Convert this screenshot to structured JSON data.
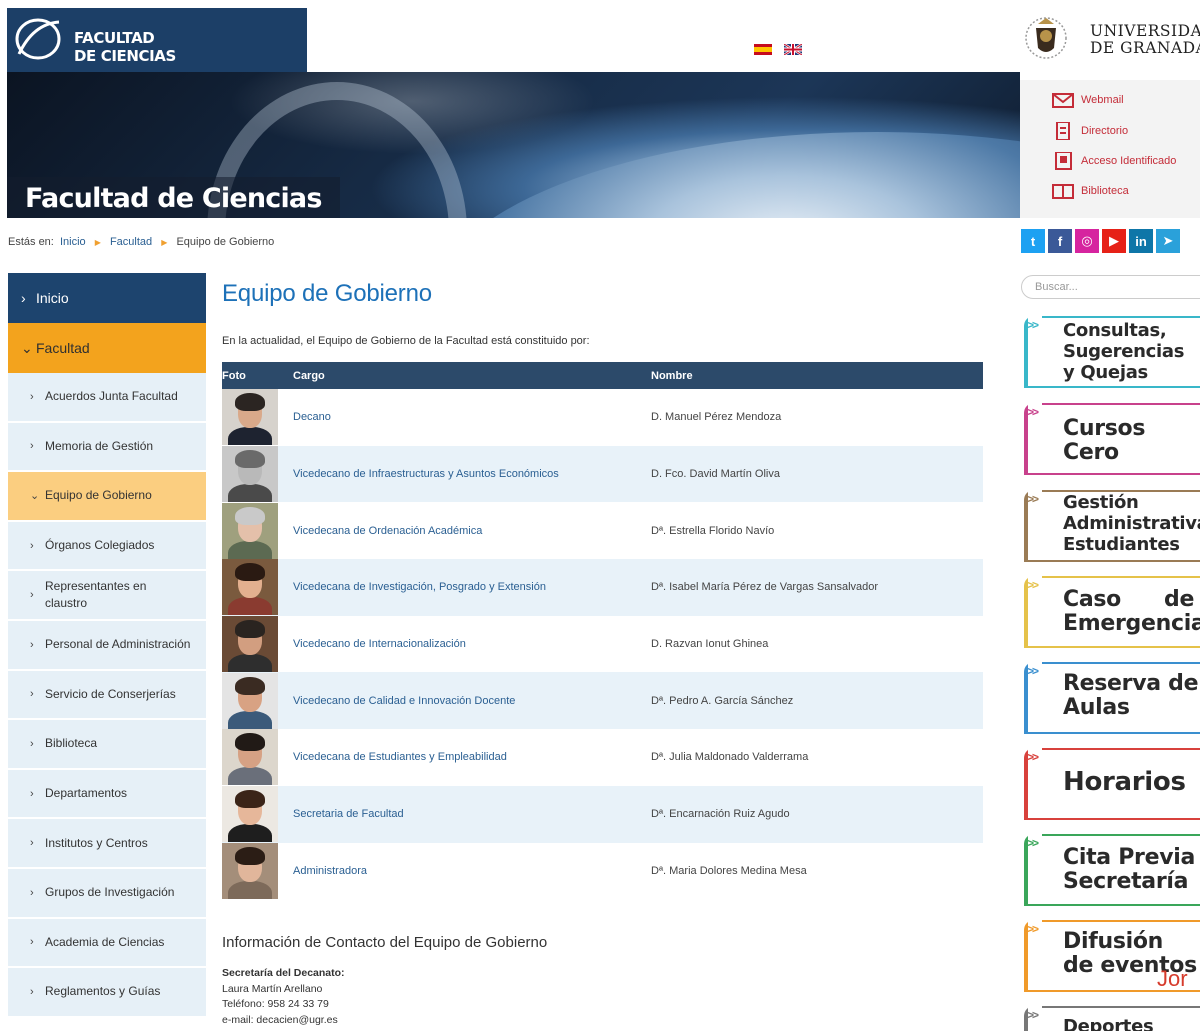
{
  "header": {
    "faculty_logo_line1": "FACULTAD",
    "faculty_logo_line2": "DE CIENCIAS",
    "university_line1": "UNIVERSIDAD",
    "university_line2": "DE GRANADA",
    "banner_title": "Facultad de Ciencias",
    "languages": [
      "es-flag-icon",
      "uk-flag-icon"
    ]
  },
  "quick_links": [
    {
      "label": "Webmail",
      "icon": "mail-icon"
    },
    {
      "label": "Directorio",
      "icon": "directory-icon"
    },
    {
      "label": "Acceso Identificado",
      "icon": "login-icon"
    },
    {
      "label": "Biblioteca",
      "icon": "book-icon"
    }
  ],
  "breadcrumb": {
    "prefix": "Estás en:",
    "items": [
      "Inicio",
      "Facultad",
      "Equipo de Gobierno"
    ]
  },
  "social": [
    "twitter-icon",
    "facebook-icon",
    "instagram-icon",
    "youtube-icon",
    "linkedin-icon",
    "telegram-icon"
  ],
  "search": {
    "placeholder": "Buscar..."
  },
  "sidebar": {
    "top_inicio": "Inicio",
    "top_facultad": "Facultad",
    "items": [
      {
        "label": "Acuerdos Junta Facultad"
      },
      {
        "label": "Memoria de Gestión"
      },
      {
        "label": "Equipo de Gobierno",
        "active": true
      },
      {
        "label": "Órganos Colegiados"
      },
      {
        "label": "Representantes en claustro"
      },
      {
        "label": "Personal de Administración"
      },
      {
        "label": "Servicio de Conserjerías"
      },
      {
        "label": "Biblioteca"
      },
      {
        "label": "Departamentos"
      },
      {
        "label": "Institutos y Centros"
      },
      {
        "label": "Grupos de Investigación"
      },
      {
        "label": "Academia de Ciencias"
      },
      {
        "label": "Reglamentos y Guías"
      }
    ]
  },
  "main": {
    "title": "Equipo de Gobierno",
    "intro": "En la actualidad, el Equipo de Gobierno de la Facultad está constituido por:",
    "table_headers": [
      "Foto",
      "Cargo",
      "Nombre"
    ],
    "rows": [
      {
        "cargo": "Decano",
        "nombre": "D. Manuel Pérez Mendoza"
      },
      {
        "cargo": "Vicedecano de Infraestructuras y Asuntos Económicos",
        "nombre": "D. Fco. David Martín Oliva"
      },
      {
        "cargo": "Vicedecana de Ordenación Académica",
        "nombre": "Dª. Estrella Florido Navío"
      },
      {
        "cargo": "Vicedecana de Investigación, Posgrado y Extensión",
        "nombre": "Dª. Isabel María Pérez de Vargas Sansalvador"
      },
      {
        "cargo": "Vicedecano de Internacionalización",
        "nombre": "D. Razvan Ionut Ghinea"
      },
      {
        "cargo": "Vicedecano de Calidad e Innovación Docente",
        "nombre": "Dª. Pedro A. García Sánchez"
      },
      {
        "cargo": "Vicedecana de Estudiantes y Empleabilidad",
        "nombre": "Dª. Julia Maldonado Valderrama"
      },
      {
        "cargo": "Secretaria de Facultad",
        "nombre": "Dª. Encarnación Ruiz Agudo"
      },
      {
        "cargo": "Administradora",
        "nombre": "Dª. Maria Dolores Medina Mesa"
      }
    ],
    "contact_title": "Información de Contacto del Equipo de Gobierno",
    "contact_heading": "Secretaría del Decanato:",
    "contact_name": "Laura Martín Arellano",
    "contact_phone": "Teléfono: 958 24 33 79",
    "contact_email": "e-mail: decacien@ugr.es"
  },
  "promo_cards": [
    {
      "line1": "Consultas,",
      "line2": "Sugerencias",
      "line3": "y Quejas",
      "color": "#39b7c9"
    },
    {
      "line1": "Cursos",
      "line2": "Cero",
      "line3": "",
      "color": "#c8418c"
    },
    {
      "line1": "Gestión",
      "line2": "Administrativa",
      "line3": "Estudiantes",
      "color": "#9a7b55"
    },
    {
      "line1": "Caso",
      "line2": "Emergencia",
      "line3": "",
      "extra": "de",
      "color": "#e5c24a"
    },
    {
      "line1": "Reserva de",
      "line2": "Aulas",
      "line3": "",
      "color": "#3a8fcf"
    },
    {
      "line1": "Horarios",
      "line2": "",
      "line3": "",
      "color": "#d8413c"
    },
    {
      "line1": "Cita Previa",
      "line2": "Secretaría",
      "line3": "",
      "color": "#3aa65a"
    },
    {
      "line1": "Difusión",
      "line2": "de eventos",
      "line3": "",
      "color": "#f09a2a"
    },
    {
      "line1": "Deportes",
      "line2": "",
      "line3": "",
      "color": "#777777"
    }
  ],
  "overlay_text": "Jor",
  "colors": {
    "navy": "#1d446e",
    "orange": "#f3a31d",
    "title_blue": "#1d71b8",
    "table_header": "#2c4a6a",
    "row_alt": "#e8f2f9",
    "link_red": "#c42c38"
  }
}
